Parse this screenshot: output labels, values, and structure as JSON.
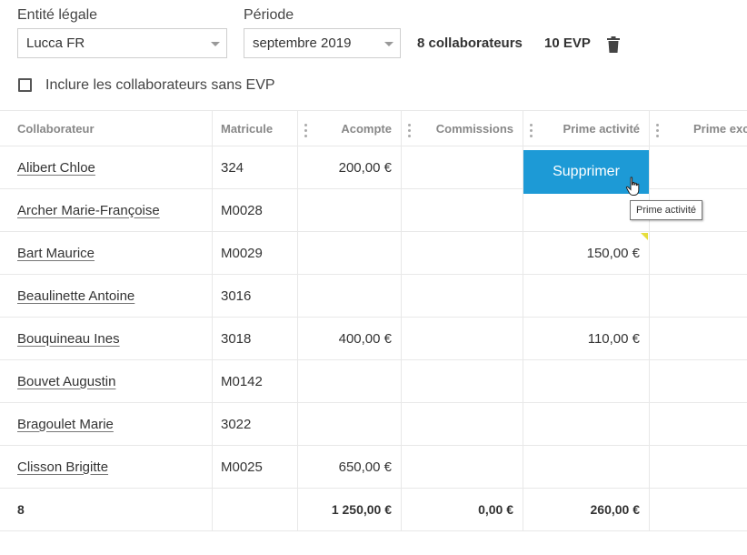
{
  "filters": {
    "entity_label": "Entité légale",
    "entity_value": "Lucca FR",
    "period_label": "Période",
    "period_value": "septembre 2019",
    "employees_count": "8 collaborateurs",
    "evp_count": "10 EVP",
    "include_label": "Inclure les collaborateurs sans EVP",
    "include_checked": false
  },
  "table": {
    "headers": [
      "Collaborateur",
      "Matricule",
      "Acompte",
      "Commissions",
      "Prime activité",
      "Prime exc"
    ],
    "rows": [
      {
        "name": "Alibert Chloe",
        "id": "324",
        "acompte": "200,00 €",
        "commissions": "",
        "prime": ""
      },
      {
        "name": "Archer Marie-Françoise",
        "id": "M0028",
        "acompte": "",
        "commissions": "",
        "prime": ""
      },
      {
        "name": "Bart Maurice",
        "id": "M0029",
        "acompte": "",
        "commissions": "",
        "prime": "150,00 €"
      },
      {
        "name": "Beaulinette Antoine",
        "id": "3016",
        "acompte": "",
        "commissions": "",
        "prime": ""
      },
      {
        "name": "Bouquineau Ines",
        "id": "3018",
        "acompte": "400,00 €",
        "commissions": "",
        "prime": "110,00 €"
      },
      {
        "name": "Bouvet Augustin",
        "id": "M0142",
        "acompte": "",
        "commissions": "",
        "prime": ""
      },
      {
        "name": "Bragoulet Marie",
        "id": "3022",
        "acompte": "",
        "commissions": "",
        "prime": ""
      },
      {
        "name": "Clisson Brigitte",
        "id": "M0025",
        "acompte": "650,00 €",
        "commissions": "",
        "prime": ""
      }
    ],
    "footer": {
      "count": "8",
      "acompte": "1 250,00 €",
      "commissions": "0,00 €",
      "prime": "260,00 €"
    }
  },
  "delete_button": "Supprimer",
  "tooltip": "Prime activité",
  "colors": {
    "accent": "#1d9ad6",
    "flag": "#e6de3d"
  }
}
